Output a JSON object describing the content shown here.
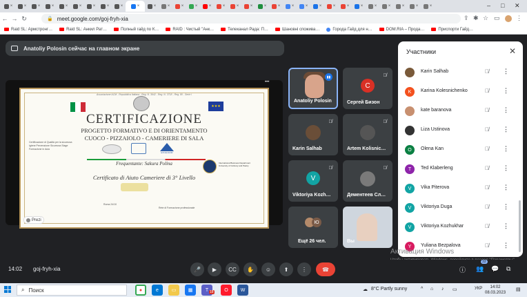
{
  "tabs": [
    {
      "label": "T",
      "color": "#555"
    },
    {
      "label": "T",
      "color": "#555"
    },
    {
      "label": "T",
      "color": "#555"
    },
    {
      "label": "T",
      "color": "#555"
    },
    {
      "label": "T",
      "color": "#555"
    },
    {
      "label": "T",
      "color": "#555"
    },
    {
      "label": "T",
      "color": "#555"
    },
    {
      "label": "T",
      "color": "#555"
    },
    {
      "label": "T",
      "color": "#555"
    },
    {
      "label": "",
      "color": "#1877f2"
    },
    {
      "label": "",
      "color": "#555"
    },
    {
      "label": "",
      "color": "#777"
    },
    {
      "label": "",
      "color": "#ea4335"
    },
    {
      "label": "",
      "color": "#34a853"
    },
    {
      "label": "",
      "color": "#ff0000"
    },
    {
      "label": "",
      "color": "#ea4335"
    },
    {
      "label": "",
      "color": "#ea4335"
    },
    {
      "label": "",
      "color": "#ea4335"
    },
    {
      "label": "",
      "color": "#1e8e3e"
    },
    {
      "label": "",
      "color": "#ea4335"
    },
    {
      "label": "",
      "color": "#4285f4"
    },
    {
      "label": "",
      "color": "#4285f4"
    },
    {
      "label": "",
      "color": "#1a73e8"
    },
    {
      "label": "",
      "color": "#ea4335"
    },
    {
      "label": "",
      "color": "#ea4335"
    },
    {
      "label": "",
      "color": "#1a73e8"
    },
    {
      "label": "",
      "color": "#777"
    },
    {
      "label": "",
      "color": "#777"
    },
    {
      "label": "",
      "color": "#777"
    },
    {
      "label": "",
      "color": "#777"
    },
    {
      "label": "",
      "color": "#777"
    }
  ],
  "address": "meet.google.com/goj-fryh-xia",
  "bookmarks": [
    "Raid SL: Армстронг…",
    "Raid SL: Анкил Рат…",
    "Полный гайд по К…",
    "RAID : Чистый \"Анк…",
    "Телеканал Рада: П…",
    "Шановні споживa…",
    "Города Гайд для н…",
    "DOM.RIA – Прода…",
    "Приспорти Гайд…"
  ],
  "presenter_banner": "Anatoliy Polosin сейчас на главном экране",
  "slide": {
    "top_line": "Associazione ACM - Repubblica Italiana - Reg. N. 3642 - Reg. N. 3718 - Reg. 80 - Serie I",
    "title": "CERTIFICAZIONE",
    "subtitle1": "PROGETTO FORMATIVO E DI ORIENTAMENTO",
    "subtitle2": "CUOCO - PIZZAIOLO - CAMERIERE DI SALA",
    "logo3_label": "EXCELSIOR",
    "name_line": "Frequentante: Sakura Polina",
    "attestato": "Certificato di Aiuto Cameriere di 3° Livello",
    "left_text": "Certificazione di Qualità per la sicurezza Igiene Prevenzione Sicurezza Stage Formazione in Aula",
    "seal_text": "International Business Department University of Culinary and Pastry",
    "bottom_left": "Roma 24/10",
    "bottom_right": "Rete di Formazione professionale",
    "prezi": "Prezi"
  },
  "tiles": [
    {
      "name": "Anatoliy Polosin"
    },
    {
      "name": "Сергей Бизон",
      "initial": "С",
      "color": "#d93025"
    },
    {
      "name": "Karin Salhab"
    },
    {
      "name": "Artem Kolisnic…"
    },
    {
      "name": "Viktoriya Kozh…",
      "initial": "V",
      "color": "#12a4a4"
    },
    {
      "name": "Дементеев Сл…"
    },
    {
      "name": "Ещё 26 чел.",
      "initial": "Ю"
    },
    {
      "name": "Вы"
    }
  ],
  "panel": {
    "title": "Участники",
    "participants": [
      {
        "name": "Karin Salhab",
        "initial": "",
        "color": "#7a5a3a"
      },
      {
        "name": "Karina Kolesnichenko",
        "initial": "K",
        "color": "#f4511e"
      },
      {
        "name": "kate baranova",
        "initial": "",
        "color": "#c89070"
      },
      {
        "name": "Liza Ustinova",
        "initial": "",
        "color": "#333333"
      },
      {
        "name": "Olena Kan",
        "initial": "O",
        "color": "#0b8043"
      },
      {
        "name": "Ted Klaberleng",
        "initial": "T",
        "color": "#8e24aa"
      },
      {
        "name": "Vika Piterova",
        "initial": "V",
        "color": "#12a4a4"
      },
      {
        "name": "Viktoriya Duga",
        "initial": "V",
        "color": "#12a4a4"
      },
      {
        "name": "Viktoriya Kozhukhar",
        "initial": "V",
        "color": "#12a4a4"
      },
      {
        "name": "Yuliana Bezpalova",
        "initial": "Y",
        "color": "#d81b60"
      }
    ]
  },
  "bottom": {
    "time": "14:02",
    "code": "goj-fryh-xia",
    "badge": "33"
  },
  "watermark": {
    "line1": "Активация Windows",
    "line2": "Чтобы активировать Windows, перейдите в раздел \"Параметры\"."
  },
  "taskbar": {
    "search_placeholder": "Поиск",
    "weather": "8°C  Partly sunny",
    "lang": "УКР",
    "time": "14:02",
    "date": "08.03.2023",
    "notif": "18"
  }
}
